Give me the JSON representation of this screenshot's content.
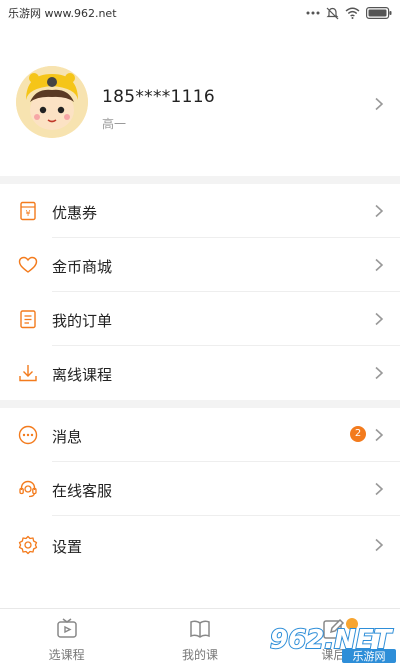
{
  "status_bar": {
    "left_text": "乐游网 www.962.net"
  },
  "profile": {
    "phone": "185****1116",
    "grade": "高一"
  },
  "menu_group_1": [
    {
      "label": "优惠券",
      "icon": "coupon-icon"
    },
    {
      "label": "金币商城",
      "icon": "heart-icon"
    },
    {
      "label": "我的订单",
      "icon": "order-icon"
    },
    {
      "label": "离线课程",
      "icon": "download-icon"
    }
  ],
  "menu_group_2": [
    {
      "label": "消息",
      "icon": "message-icon",
      "badge": "2"
    },
    {
      "label": "在线客服",
      "icon": "customer-service-icon"
    },
    {
      "label": "设置",
      "icon": "settings-icon"
    }
  ],
  "tabs": [
    {
      "label": "选课程",
      "icon": "tv-icon"
    },
    {
      "label": "我的课",
      "icon": "book-icon"
    },
    {
      "label": "课后",
      "icon": "edit-icon"
    }
  ],
  "watermark": {
    "brand": "962.NET",
    "subtitle": "乐游网"
  },
  "colors": {
    "accent": "#f37b1d",
    "text": "#222222",
    "muted": "#999999",
    "divider": "#eeeeee",
    "group_gap": "#f3f3f3"
  }
}
